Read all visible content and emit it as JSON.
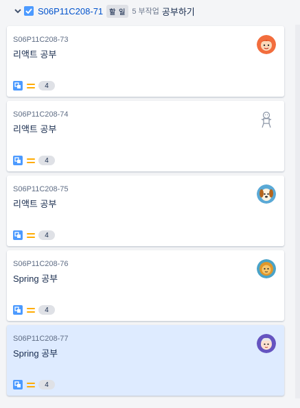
{
  "header": {
    "parent_key": "S06P11C208-71",
    "status": "할 일",
    "subtask_count": "5 부작업",
    "parent_summary": "공부하기"
  },
  "cards": [
    {
      "key": "S06P11C208-73",
      "summary": "리액트 공부",
      "points": "4",
      "avatar": "avatar-orange-face",
      "selected": false
    },
    {
      "key": "S06P11C208-74",
      "summary": "리액트 공부",
      "points": "4",
      "avatar": "avatar-gingerbread-outline",
      "selected": false
    },
    {
      "key": "S06P11C208-75",
      "summary": "리액트 공부",
      "points": "4",
      "avatar": "avatar-dog-face",
      "selected": false
    },
    {
      "key": "S06P11C208-76",
      "summary": "Spring 공부",
      "points": "4",
      "avatar": "avatar-lion-face",
      "selected": false
    },
    {
      "key": "S06P11C208-77",
      "summary": "Spring 공부",
      "points": "4",
      "avatar": "avatar-person-face",
      "selected": true
    }
  ],
  "colors": {
    "link": "#0052cc",
    "checkbox": "#4c9aff",
    "selected_card": "#deebff",
    "priority_medium": "#ffab00"
  }
}
